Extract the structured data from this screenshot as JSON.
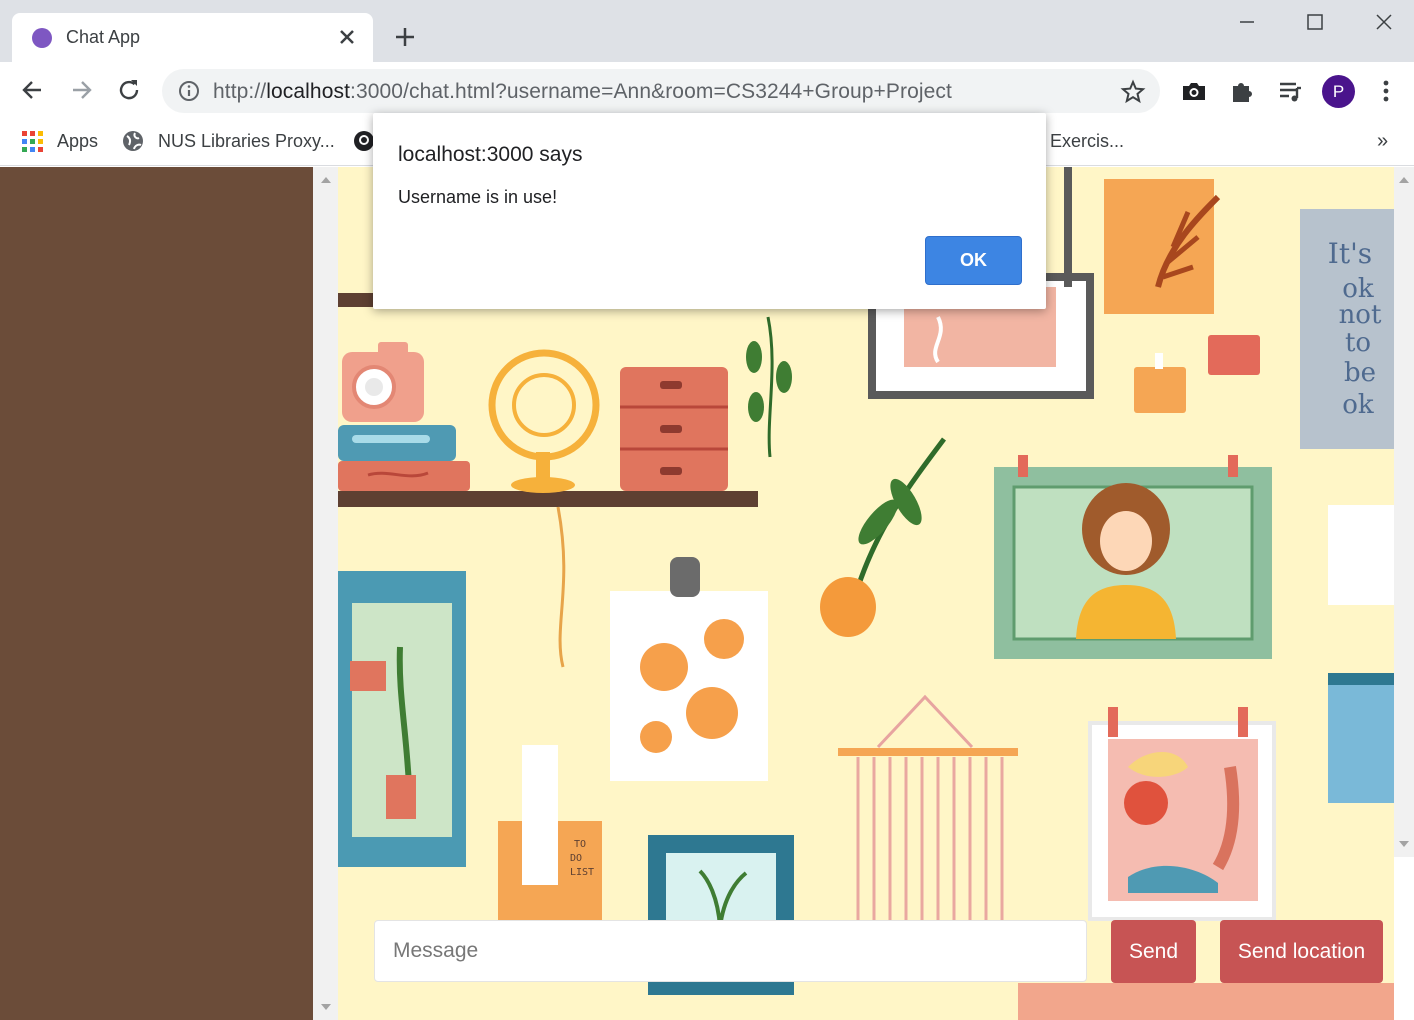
{
  "browser": {
    "tab_title": "Chat App",
    "url_scheme": "http://",
    "url_host": "localhost",
    "url_rest": ":3000/chat.html?username=Ann&room=CS3244+Group+Project",
    "profile_initial": "P",
    "bookmarks": {
      "apps": "Apps",
      "nus": "NUS Libraries Proxy...",
      "exercise": "Exercis...",
      "more": "»"
    }
  },
  "dialog": {
    "title": "localhost:3000 says",
    "message": "Username is in use!",
    "ok_label": "OK"
  },
  "chat": {
    "message_placeholder": "Message",
    "send_label": "Send",
    "send_location_label": "Send location"
  },
  "colors": {
    "sidebar": "#6b4c39",
    "accent_button": "#c75454",
    "dialog_button": "#3d85e3",
    "wallpaper": "#fff6c7"
  },
  "icons": [
    "circle-favicon",
    "close-icon",
    "plus-icon",
    "minimize-icon",
    "maximize-icon",
    "back-arrow-icon",
    "forward-arrow-icon",
    "reload-icon",
    "info-icon",
    "star-icon",
    "camera-icon",
    "puzzle-icon",
    "playlist-icon",
    "kebab-menu-icon",
    "apps-grid-icon",
    "globe-icon",
    "github-icon"
  ]
}
